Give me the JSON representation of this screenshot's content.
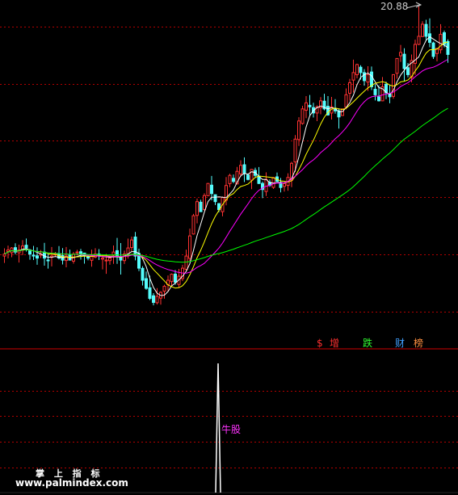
{
  "header": {
    "peak_label": "20.88"
  },
  "legend": {
    "items": [
      {
        "text": "$",
        "color": "#ff3030"
      },
      {
        "text": "增",
        "color": "#ff3030"
      },
      {
        "text": "跌",
        "color": "#30ff30"
      },
      {
        "text": "财",
        "color": "#40a0ff"
      },
      {
        "text": "榜",
        "color": "#ff9040"
      }
    ]
  },
  "indicator": {
    "signal_label": "牛股"
  },
  "watermark": {
    "line1": "掌 上 指 标",
    "line2": "www.palmindex.com"
  },
  "colors": {
    "up": "#ff3232",
    "down": "#54fcfc",
    "ma5": "#ffffff",
    "ma10": "#ffff00",
    "ma20": "#ff00ff",
    "ma60": "#00ff00",
    "grid": "#b40000",
    "signal": "#ffffff"
  },
  "chart_data": [
    {
      "type": "candlestick",
      "peak_high": 20.88,
      "closes": [
        8.6,
        8.8,
        8.9,
        8.7,
        8.8,
        9.0,
        8.9,
        8.6,
        8.5,
        8.4,
        8.6,
        8.4,
        8.3,
        8.5,
        8.6,
        8.4,
        8.3,
        8.5,
        8.3,
        8.6,
        8.7,
        8.6,
        8.5,
        8.4,
        8.5,
        8.6,
        8.5,
        8.4,
        8.3,
        8.4,
        8.7,
        8.5,
        8.3,
        8.6,
        8.9,
        9.3,
        8.5,
        7.9,
        7.3,
        6.9,
        6.4,
        6.2,
        6.5,
        6.7,
        7.0,
        7.3,
        7.6,
        7.2,
        7.5,
        7.9,
        8.5,
        9.5,
        10.5,
        11.2,
        10.7,
        11.5,
        12.1,
        11.6,
        11.2,
        10.8,
        11.4,
        12.0,
        12.5,
        12.2,
        12.7,
        13.0,
        12.6,
        12.3,
        12.8,
        12.5,
        12.1,
        11.8,
        12.3,
        12.0,
        12.4,
        12.2,
        11.9,
        12.1,
        12.4,
        13.1,
        14.3,
        15.2,
        15.8,
        16.1,
        15.9,
        15.6,
        15.9,
        16.2,
        15.8,
        15.5,
        15.9,
        15.7,
        15.4,
        15.8,
        16.5,
        17.1,
        17.6,
        18.0,
        17.6,
        17.2,
        17.5,
        16.9,
        16.5,
        16.2,
        16.9,
        16.6,
        16.4,
        17.5,
        18.3,
        18.6,
        17.8,
        17.5,
        18.2,
        19.0,
        19.4,
        20.0,
        19.4,
        19.1,
        18.4,
        18.8,
        19.5,
        19.0,
        18.5
      ]
    },
    {
      "type": "line",
      "series": [
        {
          "values": [
            0,
            0,
            0,
            0,
            0,
            0,
            0,
            0,
            0,
            0,
            0,
            0,
            0,
            0,
            0,
            0,
            0,
            0,
            0,
            0,
            0,
            0,
            0,
            0,
            0,
            0,
            0,
            0,
            0,
            0,
            0,
            0,
            0,
            0,
            0,
            0,
            0,
            0,
            0,
            0,
            0,
            0,
            0,
            0,
            0,
            0,
            0,
            0,
            0,
            0,
            0,
            0,
            1,
            0,
            0,
            0,
            0,
            0,
            0,
            0,
            0,
            0,
            0,
            0,
            0,
            0,
            0,
            0,
            0,
            0,
            0,
            0,
            0,
            0,
            0,
            0,
            0,
            0,
            0,
            0,
            0,
            0,
            0,
            0,
            0,
            0,
            0,
            0,
            0,
            0,
            0,
            0,
            0,
            0,
            0,
            0,
            0,
            0,
            0,
            0,
            0,
            0,
            0,
            0,
            0,
            0,
            0,
            0,
            0,
            0,
            0,
            0,
            0,
            0,
            0,
            0,
            0,
            0,
            0,
            0,
            0,
            0,
            0
          ]
        }
      ]
    }
  ]
}
